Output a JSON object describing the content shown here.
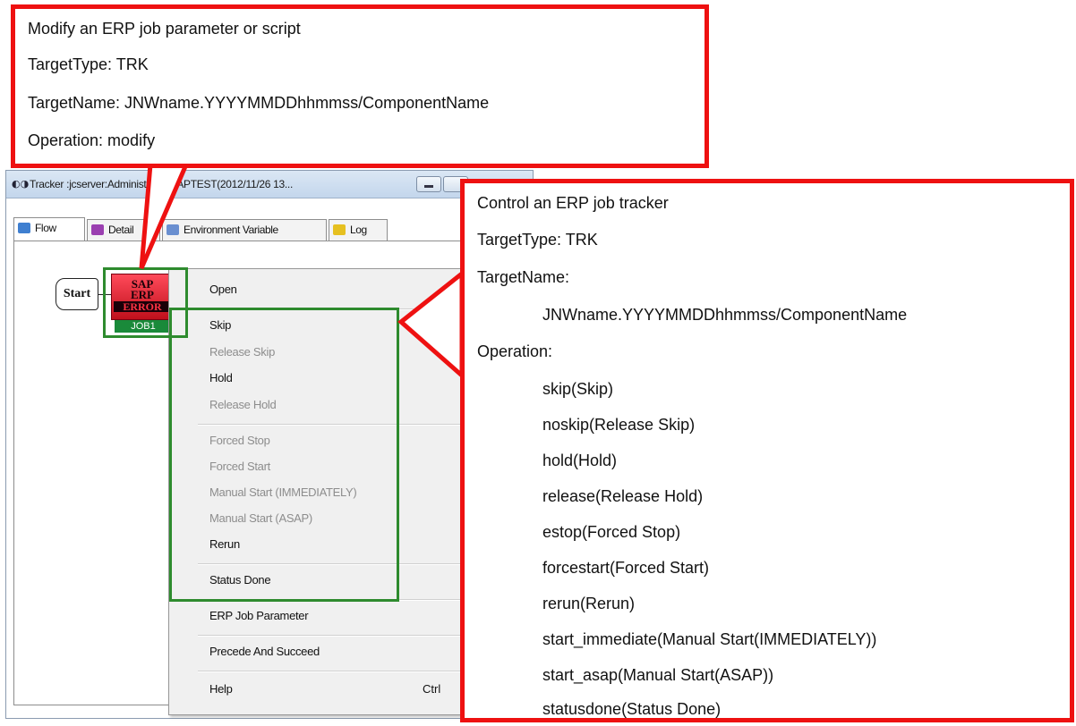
{
  "window": {
    "title": "Tracker :jcserver:Administrator:SAPTEST(2012/11/26 13...",
    "tabs": [
      {
        "label": "Flow",
        "icon": "flow-icon"
      },
      {
        "label": "Detail",
        "icon": "detail-icon"
      },
      {
        "label": "Environment Variable",
        "icon": "env-icon"
      },
      {
        "label": "Log",
        "icon": "log-icon"
      }
    ]
  },
  "flow": {
    "start_label": "Start",
    "job": {
      "icon_lines": [
        "SAP",
        "ERP",
        "ERROR"
      ],
      "label": "JOB1"
    }
  },
  "menu": {
    "items": [
      {
        "label": "Open",
        "enabled": true
      },
      {
        "label": "Skip",
        "enabled": true
      },
      {
        "label": "Release Skip",
        "enabled": false
      },
      {
        "label": "Hold",
        "enabled": true
      },
      {
        "label": "Release Hold",
        "enabled": false
      },
      {
        "label": "Forced Stop",
        "enabled": false
      },
      {
        "label": "Forced Start",
        "enabled": false
      },
      {
        "label": "Manual Start (IMMEDIATELY)",
        "enabled": false
      },
      {
        "label": "Manual Start (ASAP)",
        "enabled": false
      },
      {
        "label": "Rerun",
        "enabled": true
      },
      {
        "label": "Status Done",
        "enabled": true
      },
      {
        "label": "ERP Job Parameter",
        "enabled": true
      },
      {
        "label": "Precede And Succeed",
        "enabled": true
      },
      {
        "label": "Help",
        "enabled": true,
        "shortcut": "Ctrl"
      }
    ]
  },
  "callout_top": {
    "lines": [
      "Modify an ERP job parameter or script",
      "TargetType: TRK",
      "TargetName: JNWname.YYYYMMDDhhmmss/ComponentName",
      "Operation: modify"
    ]
  },
  "callout_right": {
    "title": "Control an ERP job tracker",
    "target_type": "TargetType: TRK",
    "target_name_label": "TargetName:",
    "target_name_value": "JNWname.YYYYMMDDhhmmss/ComponentName",
    "operation_label": "Operation:",
    "operations": [
      "skip(Skip)",
      "noskip(Release Skip)",
      "hold(Hold)",
      "release(Release Hold)",
      "estop(Forced Stop)",
      "forcestart(Forced Start)",
      "rerun(Rerun)",
      "start_immediate(Manual Start(IMMEDIATELY))",
      "start_asap(Manual Start(ASAP))",
      "statusdone(Status Done)"
    ]
  },
  "colors": {
    "callout_border": "#ee1111",
    "highlight_border": "#2e8b2e",
    "disabled_text": "#8d8d8d"
  }
}
